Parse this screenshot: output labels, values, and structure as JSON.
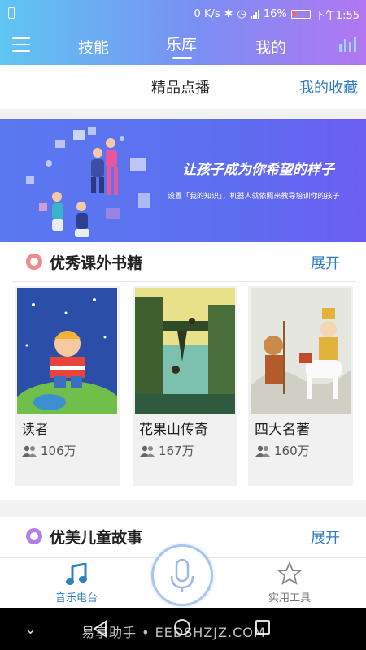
{
  "status_bar": {
    "speed": "0 K/s",
    "battery": "16%",
    "time": "下午1:55"
  },
  "tabs": [
    {
      "label": "技能"
    },
    {
      "label": "乐库"
    },
    {
      "label": "我的"
    }
  ],
  "subheader": {
    "title": "精品点播",
    "favorites": "我的收藏"
  },
  "banner": {
    "title": "让孩子成为你希望的样子",
    "subtitle": "设置「我的知识」，机器人就依照来教导培训你的孩子"
  },
  "sections": [
    {
      "title": "优秀课外书籍",
      "more": "展开",
      "dot_color": "#f08a8a",
      "items": [
        {
          "name": "读者",
          "count": "106万"
        },
        {
          "name": "花果山传奇",
          "count": "167万"
        },
        {
          "name": "四大名著",
          "count": "160万"
        }
      ]
    },
    {
      "title": "优美儿童故事",
      "more": "展开",
      "dot_color": "#b27fe6"
    }
  ],
  "bottom_nav": {
    "left": "音乐电台",
    "right": "实用工具"
  },
  "watermark": "易享助手 • EEDSHZJZ.COM",
  "colors": {
    "accent": "#2e7cc0",
    "header_start": "#5fc6f2",
    "header_end": "#b277f2"
  }
}
